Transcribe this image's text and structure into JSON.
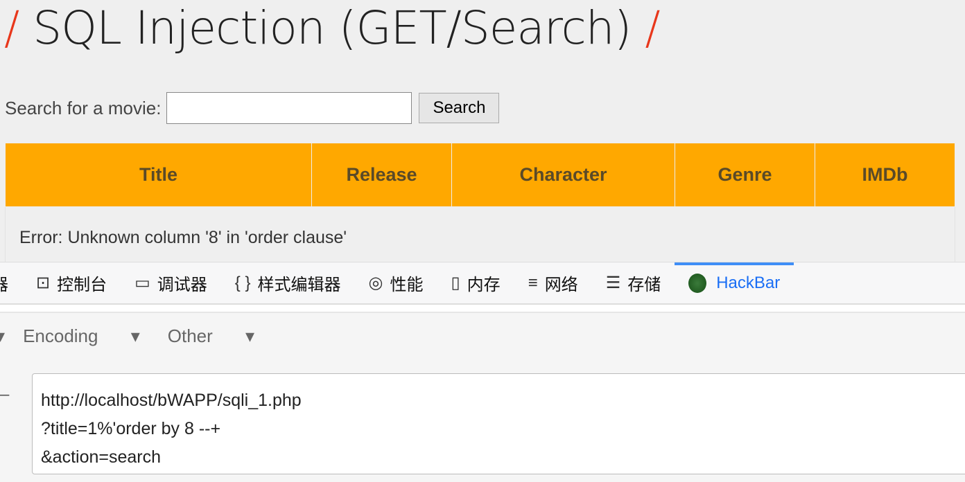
{
  "page": {
    "title": "SQL Injection (GET/Search)",
    "search_label": "Search for a movie:",
    "search_value": "",
    "search_button": "Search",
    "columns": [
      "Title",
      "Release",
      "Character",
      "Genre",
      "IMDb"
    ],
    "error": "Error: Unknown column '8' in 'order clause'"
  },
  "devtools": {
    "tabs": [
      {
        "label": "器",
        "icon": "inspector-icon"
      },
      {
        "label": "控制台",
        "icon": "console-icon"
      },
      {
        "label": "调试器",
        "icon": "debugger-icon"
      },
      {
        "label": "样式编辑器",
        "icon": "style-editor-icon"
      },
      {
        "label": "性能",
        "icon": "performance-icon"
      },
      {
        "label": "内存",
        "icon": "memory-icon"
      },
      {
        "label": "网络",
        "icon": "network-icon"
      },
      {
        "label": "存储",
        "icon": "storage-icon"
      },
      {
        "label": "HackBar",
        "icon": "hackbar-icon",
        "active": true
      }
    ]
  },
  "hackbar": {
    "menus": [
      "Encoding",
      "Other"
    ],
    "url": "http://localhost/bWAPP/sqli_1.php\n?title=1%'order by 8 --+\n&action=search"
  }
}
